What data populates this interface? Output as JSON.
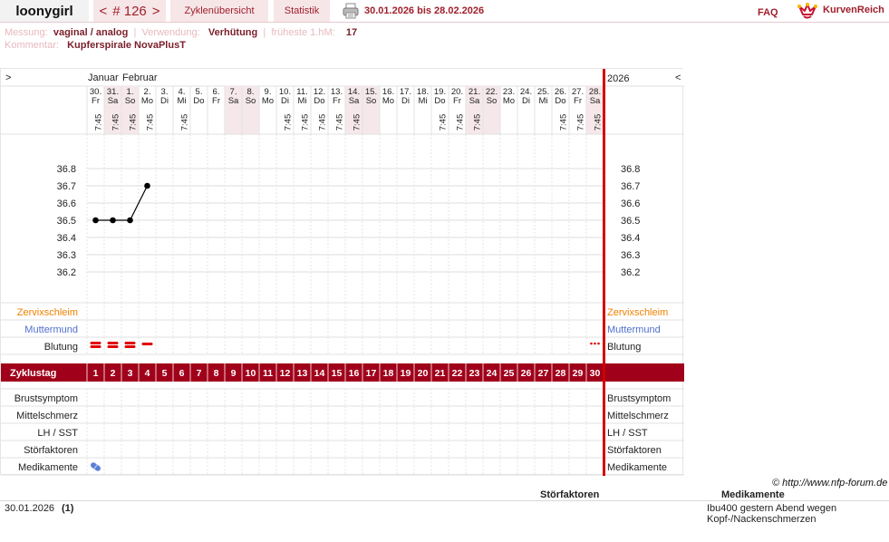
{
  "header": {
    "username": "loonygirl",
    "cycle_nav": {
      "prev": "<",
      "label": "# 126",
      "next": ">"
    },
    "tabs": [
      {
        "label": "Zyklenübersicht"
      },
      {
        "label": "Statistik"
      }
    ],
    "date_range": "30.01.2026 bis 28.02.2026",
    "faq": "FAQ",
    "logo_text": "KurvenReich"
  },
  "info": {
    "messung_label": "Messung:",
    "messung_value": "vaginal / analog",
    "verwendung_label": "Verwendung:",
    "verwendung_value": "Verhütung",
    "hm_label": "früheste 1.hM:",
    "hm_value": "17",
    "kommentar_label": "Kommentar:",
    "kommentar_value": "Kupferspirale NovaPlusT"
  },
  "chart_nav": {
    "left": ">",
    "right": "<",
    "year": "2026"
  },
  "months": [
    "Januar",
    "Februar"
  ],
  "days": [
    {
      "date": "30.",
      "wd": "Fr",
      "time": "7:45"
    },
    {
      "date": "31.",
      "wd": "Sa",
      "time": "7:45"
    },
    {
      "date": "1.",
      "wd": "So",
      "time": "7:45"
    },
    {
      "date": "2.",
      "wd": "Mo",
      "time": "7:45"
    },
    {
      "date": "3.",
      "wd": "Di",
      "time": ""
    },
    {
      "date": "4.",
      "wd": "Mi",
      "time": "7:45"
    },
    {
      "date": "5.",
      "wd": "Do",
      "time": ""
    },
    {
      "date": "6.",
      "wd": "Fr",
      "time": ""
    },
    {
      "date": "7.",
      "wd": "Sa",
      "time": ""
    },
    {
      "date": "8.",
      "wd": "So",
      "time": ""
    },
    {
      "date": "9.",
      "wd": "Mo",
      "time": ""
    },
    {
      "date": "10.",
      "wd": "Di",
      "time": "7:45"
    },
    {
      "date": "11.",
      "wd": "Mi",
      "time": "7:45"
    },
    {
      "date": "12.",
      "wd": "Do",
      "time": "7:45"
    },
    {
      "date": "13.",
      "wd": "Fr",
      "time": "7:45"
    },
    {
      "date": "14.",
      "wd": "Sa",
      "time": "7:45"
    },
    {
      "date": "15.",
      "wd": "So",
      "time": ""
    },
    {
      "date": "16.",
      "wd": "Mo",
      "time": ""
    },
    {
      "date": "17.",
      "wd": "Di",
      "time": ""
    },
    {
      "date": "18.",
      "wd": "Mi",
      "time": ""
    },
    {
      "date": "19.",
      "wd": "Do",
      "time": "7:45"
    },
    {
      "date": "20.",
      "wd": "Fr",
      "time": "7:45"
    },
    {
      "date": "21.",
      "wd": "Sa",
      "time": "7:45"
    },
    {
      "date": "22.",
      "wd": "So",
      "time": ""
    },
    {
      "date": "23.",
      "wd": "Mo",
      "time": ""
    },
    {
      "date": "24.",
      "wd": "Di",
      "time": ""
    },
    {
      "date": "25.",
      "wd": "Mi",
      "time": ""
    },
    {
      "date": "26.",
      "wd": "Do",
      "time": "7:45"
    },
    {
      "date": "27.",
      "wd": "Fr",
      "time": "7:45"
    },
    {
      "date": "28.",
      "wd": "Sa",
      "time": "7:45"
    }
  ],
  "chart_data": {
    "type": "line",
    "y_ticks": [
      "36.8",
      "36.7",
      "36.6",
      "36.5",
      "36.4",
      "36.3",
      "36.2"
    ],
    "ylim": [
      36.2,
      36.8
    ],
    "series": [
      {
        "values": [
          {
            "day": 1,
            "temp": 36.5
          },
          {
            "day": 2,
            "temp": 36.5
          },
          {
            "day": 3,
            "temp": 36.5
          },
          {
            "day": 4,
            "temp": 36.7
          }
        ]
      }
    ]
  },
  "rows": {
    "zervix": "Zervixschleim",
    "muttermund": "Muttermund",
    "blutung": "Blutung",
    "zyklustag": "Zyklustag",
    "brust": "Brustsymptom",
    "mittel": "Mittelschmerz",
    "lh": "LH / SST",
    "stoer": "Störfaktoren",
    "medi": "Medikamente"
  },
  "cycle_days": [
    "1",
    "2",
    "3",
    "4",
    "5",
    "6",
    "7",
    "8",
    "9",
    "10",
    "11",
    "12",
    "13",
    "14",
    "15",
    "16",
    "17",
    "18",
    "19",
    "20",
    "21",
    "22",
    "23",
    "24",
    "25",
    "26",
    "27",
    "28",
    "29",
    "30"
  ],
  "bleeding": [
    {
      "day": 1,
      "level": "heavy"
    },
    {
      "day": 2,
      "level": "heavy"
    },
    {
      "day": 3,
      "level": "heavy"
    },
    {
      "day": 4,
      "level": "light"
    },
    {
      "day": 30,
      "level": "spotting"
    }
  ],
  "medication_day": 1,
  "colors": {
    "accent": "#a01f2b",
    "weekend": "#f6e8ea",
    "zervix": "#f08000",
    "muttermund": "#4f6fcf",
    "bar": "#a0001a"
  },
  "footer": {
    "copyright": "© http://www.nfp-forum.de",
    "stoer_header": "Störfaktoren",
    "medi_header": "Medikamente",
    "note_date": "30.01.2026",
    "note_num": "(1)",
    "note_medi": "Ibu400 gestern Abend wegen Kopf-/Nackenschmerzen"
  }
}
